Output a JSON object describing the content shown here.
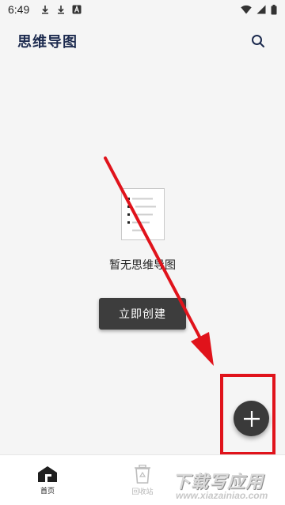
{
  "status_bar": {
    "time": "6:49",
    "left_icons": [
      "download-icon",
      "download-icon",
      "notification-a-icon"
    ],
    "right_icons": [
      "wifi-icon",
      "signal-icon",
      "battery-icon"
    ]
  },
  "app_bar": {
    "title": "思维导图",
    "action_icon": "search-icon"
  },
  "empty_state": {
    "illustration_icon": "mindmap-document-icon",
    "message": "暂无思维导图",
    "create_button_label": "立即创建"
  },
  "fab": {
    "icon": "plus-icon"
  },
  "bottom_nav": {
    "items": [
      {
        "label": "首页",
        "icon": "home-icon",
        "active": true
      },
      {
        "label": "回收站",
        "icon": "recycle-bin-icon",
        "active": false
      }
    ]
  },
  "watermark": {
    "title": "下载写应用",
    "url": "www.xiazainiao.com"
  },
  "colors": {
    "background": "#f5f5f5",
    "title": "#1d2b4f",
    "button": "#3d3d3d",
    "annotation": "#e0131b"
  }
}
